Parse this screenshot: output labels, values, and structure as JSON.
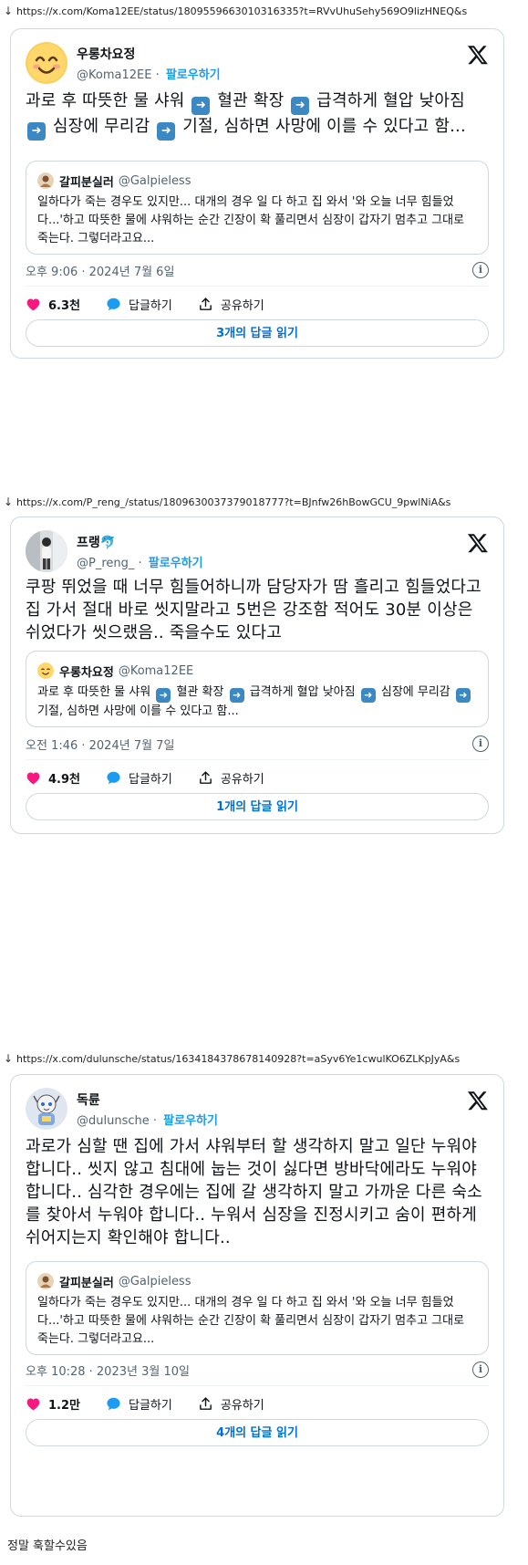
{
  "tweets": [
    {
      "url": "https://x.com/Koma12EE/status/1809559663010316335?t=RVvUhuSehy569O9lizHNEQ&s",
      "name": "우롱차요정",
      "handle": "@Koma12EE",
      "follow": "팔로우하기",
      "body": [
        "과로 후 따뜻한 물 샤워 ",
        "➡️",
        " 혈관 확장 ",
        "➡️",
        " 급격하게 혈압 낮아짐 ",
        "➡️",
        " 심장에 무리감 ",
        "➡️",
        " 기절, 심하면 사망에 이를 수 있다고 함..."
      ],
      "quote": {
        "name": "갈피분실러",
        "handle": "@Galpieless",
        "text": "일하다가 죽는 경우도 있지만... 대개의 경우 일 다 하고 집 와서 '와 오늘 너무 힘들었다...'하고 따뜻한 물에 샤워하는 순간 긴장이 확 풀리면서 심장이 갑자기 멈추고 그대로 죽는다. 그렇더라고요..."
      },
      "date": "오후 9:06 · 2024년 7월 6일",
      "likes": "6.3천",
      "reply_label": "답글하기",
      "share_label": "공유하기",
      "read_replies": "3개의 답글 읽기"
    },
    {
      "url": "https://x.com/P_reng_/status/1809630037379018777?t=BJnfw26hBowGCU_9pwlNiA&s",
      "name": "프랭🐬",
      "handle": "@P_reng_",
      "follow": "팔로우하기",
      "body": [
        "쿠팡 뛰었을 때 너무 힘들어하니까 담당자가 땀 흘리고 힘들었다고 집 가서 절대 바로 씻지말라고 5번은 강조함 적어도 30분 이상은 쉬었다가 씻으랬음.. 죽을수도 있다고"
      ],
      "quote": {
        "name": "우롱차요정",
        "handle": "@Koma12EE",
        "text_parts": [
          "과로 후 따뜻한 물 샤워 ",
          "➡️",
          " 혈관 확장 ",
          "➡️",
          " 급격하게 혈압 낮아짐 ",
          "➡️",
          " 심장에 무리감 ",
          "➡️",
          " 기절, 심하면 사망에 이를 수 있다고 함..."
        ]
      },
      "date": "오전 1:46 · 2024년 7월 7일",
      "likes": "4.9천",
      "reply_label": "답글하기",
      "share_label": "공유하기",
      "read_replies": "1개의 답글 읽기"
    },
    {
      "url": "https://x.com/dulunsche/status/1634184378678140928?t=aSyv6Ye1cwulKO6ZLKpJyA&s",
      "name": "독륜",
      "handle": "@dulunsche",
      "follow": "팔로우하기",
      "body": [
        "과로가 심할 땐 집에 가서 샤워부터 할 생각하지 말고 일단 누워야 합니다.. 씻지 않고 침대에 눕는 것이 싫다면 방바닥에라도 누워야 합니다.. 심각한 경우에는 집에 갈 생각하지 말고 가까운 다른 숙소를 찾아서 누워야 합니다.. 누워서 심장을 진정시키고 숨이 편하게 쉬어지는지 확인해야 합니다.."
      ],
      "quote": {
        "name": "갈피분실러",
        "handle": "@Galpieless",
        "text": "일하다가 죽는 경우도 있지만... 대개의 경우 일 다 하고 집 와서 '와 오늘 너무 힘들었다...'하고 따뜻한 물에 샤워하는 순간 긴장이 확 풀리면서 심장이 갑자기 멈추고 그대로 죽는다. 그렇더라고요..."
      },
      "date": "오후 10:28 · 2023년 3월 10일",
      "likes": "1.2만",
      "reply_label": "답글하기",
      "share_label": "공유하기",
      "read_replies": "4개의 답글 읽기"
    }
  ],
  "caption": "정말 훅할수있음",
  "colors": {
    "accent": "#1d9bf0",
    "like": "#f91880",
    "reply": "#1d9bf0",
    "link": "#006fd6",
    "arrow_emoji": "#3b88c3"
  },
  "icons": [
    "download-arrow-icon",
    "x-logo-icon",
    "heart-icon",
    "reply-bubble-icon",
    "share-icon",
    "info-icon",
    "arrow-emoji-icon"
  ]
}
